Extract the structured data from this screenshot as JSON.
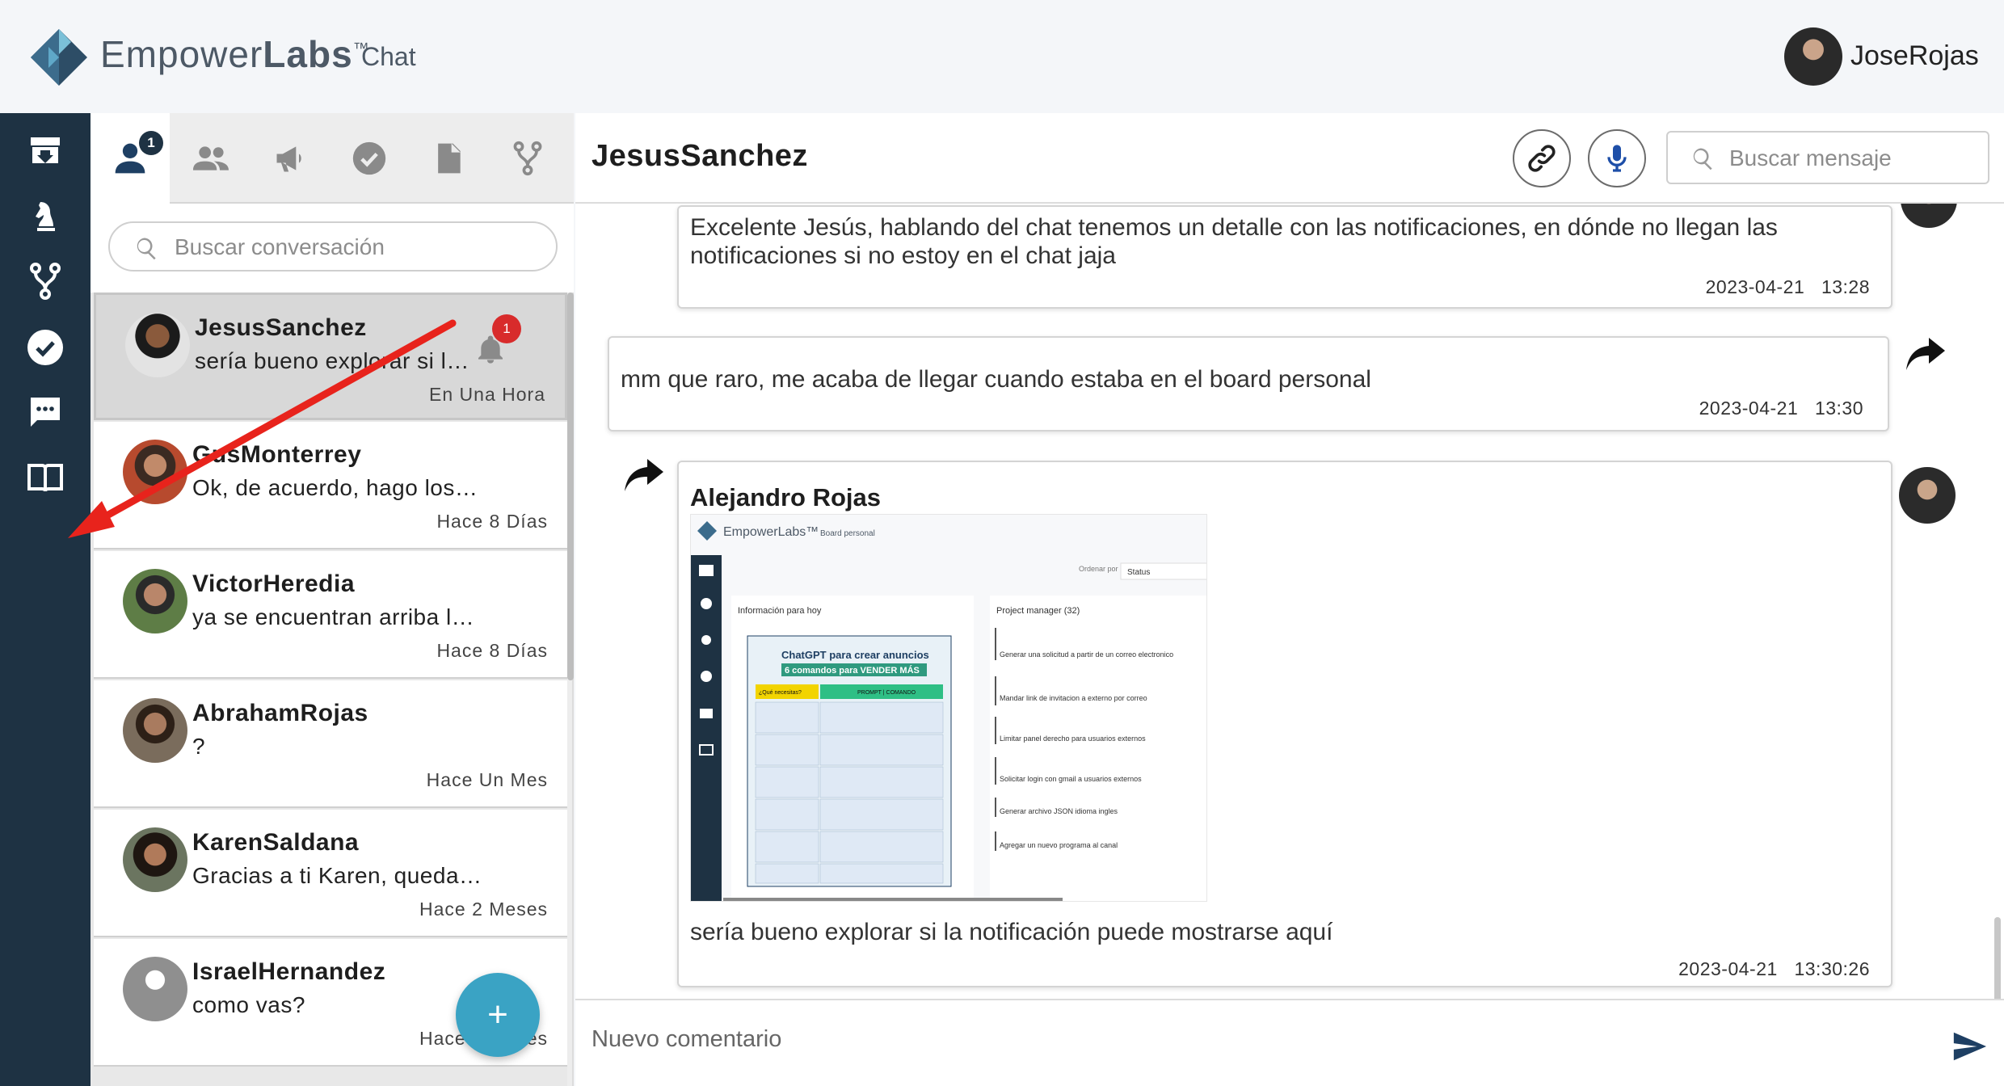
{
  "app": {
    "logo_name_light": "Empower",
    "logo_name_bold": "Labs",
    "logo_tm": "™",
    "section": "Chat",
    "user_name": "JoseRojas"
  },
  "colors": {
    "rail": "#1e3243",
    "accent": "#3aa3c4",
    "badge_red": "#d82b2b",
    "annotation_arrow": "#e8231c"
  },
  "rail_icons": [
    "inbox-icon",
    "chess-knight-icon",
    "fork-icon",
    "check-circle-icon",
    "chat-bubble-icon",
    "book-icon"
  ],
  "conv_tabs": [
    {
      "icon": "person-icon",
      "badge": "1",
      "active": true
    },
    {
      "icon": "group-icon"
    },
    {
      "icon": "megaphone-icon"
    },
    {
      "icon": "check-circle-icon"
    },
    {
      "icon": "document-icon"
    },
    {
      "icon": "fork-icon"
    }
  ],
  "conv_search": {
    "placeholder": "Buscar conversación"
  },
  "conversations": [
    {
      "name": "JesusSanchez",
      "last": "sería bueno explorar si l…",
      "time": "En Una Hora",
      "notification": "1",
      "selected": true
    },
    {
      "name": "GusMonterrey",
      "last": "Ok, de acuerdo, hago los…",
      "time": "Hace 8 Días"
    },
    {
      "name": "VictorHeredia",
      "last": "ya se encuentran arriba l…",
      "time": "Hace 8 Días"
    },
    {
      "name": "AbrahamRojas",
      "last": "?",
      "time": "Hace Un Mes"
    },
    {
      "name": "KarenSaldana",
      "last": "Gracias a ti Karen, queda…",
      "time": "Hace 2 Meses"
    },
    {
      "name": "IsraelHernandez",
      "last": "como vas?",
      "time": "Hace 3 Meses"
    }
  ],
  "fab_label": "+",
  "chat": {
    "title": "JesusSanchez",
    "search_placeholder": "Buscar mensaje",
    "messages": [
      {
        "text": "Excelente Jesús, hablando del chat tenemos un detalle con las notificaciones, en dónde no llegan las notificaciones si no estoy en el chat jaja",
        "date": "2023-04-21",
        "time": "13:28"
      },
      {
        "text": "mm que raro, me acaba de llegar cuando estaba en el board personal",
        "date": "2023-04-21",
        "time": "13:30"
      },
      {
        "sender": "Alejandro Rojas",
        "text": "sería bueno explorar si la notificación puede mostrarse aquí",
        "date": "2023-04-21",
        "time": "13:30:26"
      }
    ],
    "composer_placeholder": "Nuevo comentario"
  },
  "embedded_screenshot": {
    "logo": "EmpowerLabs™",
    "section": "Board personal",
    "filter_label": "Ordenar por",
    "filter_value": "Status",
    "panel_left_title": "Información para hoy",
    "panel_right_title": "Project manager (32)",
    "card_title": "ChatGPT para crear anuncios",
    "card_subtitle": "6 comandos para VENDER MÁS",
    "card_col1": "¿Qué necesitas?",
    "card_col2": "PROMPT | COMANDO",
    "tasks": [
      "Generar una solicitud a partir de un correo electronico",
      "Mandar link de invitacion a externo por correo",
      "Limitar panel derecho para usuarios externos",
      "Solicitar login con gmail a usuarios externos",
      "Generar archivo JSON idioma ingles",
      "Agregar un nuevo programa al canal"
    ]
  }
}
